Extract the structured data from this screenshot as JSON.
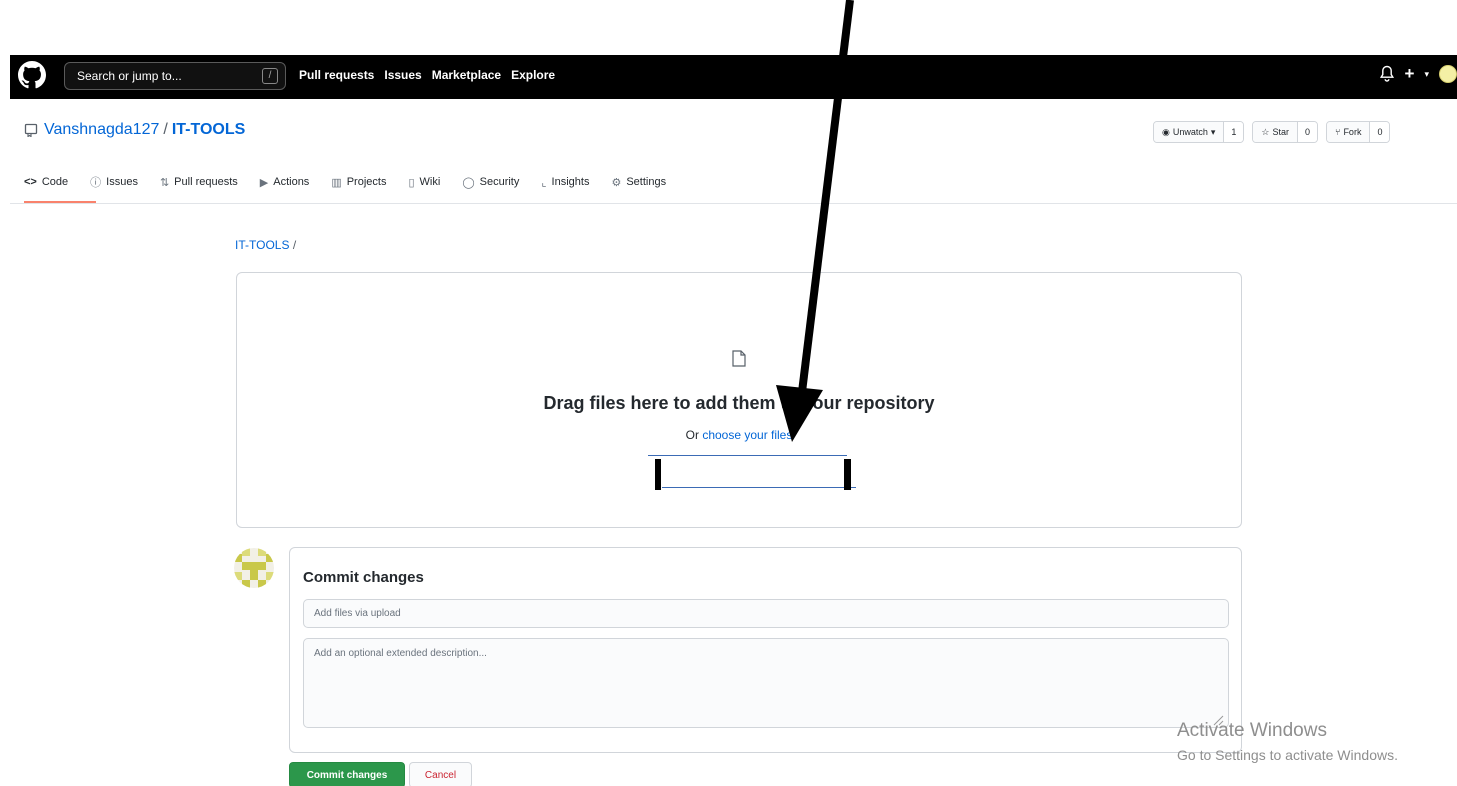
{
  "header": {
    "search_placeholder": "Search or jump to...",
    "search_shortcut": "/",
    "nav": [
      "Pull requests",
      "Issues",
      "Marketplace",
      "Explore"
    ]
  },
  "repo": {
    "owner": "Vanshnagda127",
    "separator": "/",
    "name": "IT-TOOLS",
    "watch_label": "Unwatch",
    "watch_count": "1",
    "star_label": "Star",
    "star_count": "0",
    "fork_label": "Fork",
    "fork_count": "0"
  },
  "tabs": [
    {
      "label": "Code",
      "icon": "code-icon",
      "glyph": "<>"
    },
    {
      "label": "Issues",
      "icon": "issue-icon",
      "glyph": "ⓘ"
    },
    {
      "label": "Pull requests",
      "icon": "pull-request-icon",
      "glyph": "⇅"
    },
    {
      "label": "Actions",
      "icon": "play-icon",
      "glyph": "▶"
    },
    {
      "label": "Projects",
      "icon": "project-icon",
      "glyph": "▥"
    },
    {
      "label": "Wiki",
      "icon": "book-icon",
      "glyph": "▯"
    },
    {
      "label": "Security",
      "icon": "shield-icon",
      "glyph": "◯"
    },
    {
      "label": "Insights",
      "icon": "graph-icon",
      "glyph": "⌞"
    },
    {
      "label": "Settings",
      "icon": "gear-icon",
      "glyph": "⚙"
    }
  ],
  "breadcrumb": {
    "repo": "IT-TOOLS",
    "separator": "/"
  },
  "upload": {
    "drop_text": "Drag files here to add them to your repository",
    "choose_prefix": "Or ",
    "choose_link": "choose your files"
  },
  "commit": {
    "title": "Commit changes",
    "summary_placeholder": "Add files via upload",
    "description_placeholder": "Add an optional extended description...",
    "commit_button": "Commit changes",
    "cancel_button": "Cancel"
  },
  "watermark": {
    "title": "Activate Windows",
    "subtitle": "Go to Settings to activate Windows."
  },
  "colors": {
    "link": "#0366d6",
    "commit_green": "#2c974b",
    "cancel_red": "#cb2431",
    "tab_underline": "#f9826c"
  }
}
